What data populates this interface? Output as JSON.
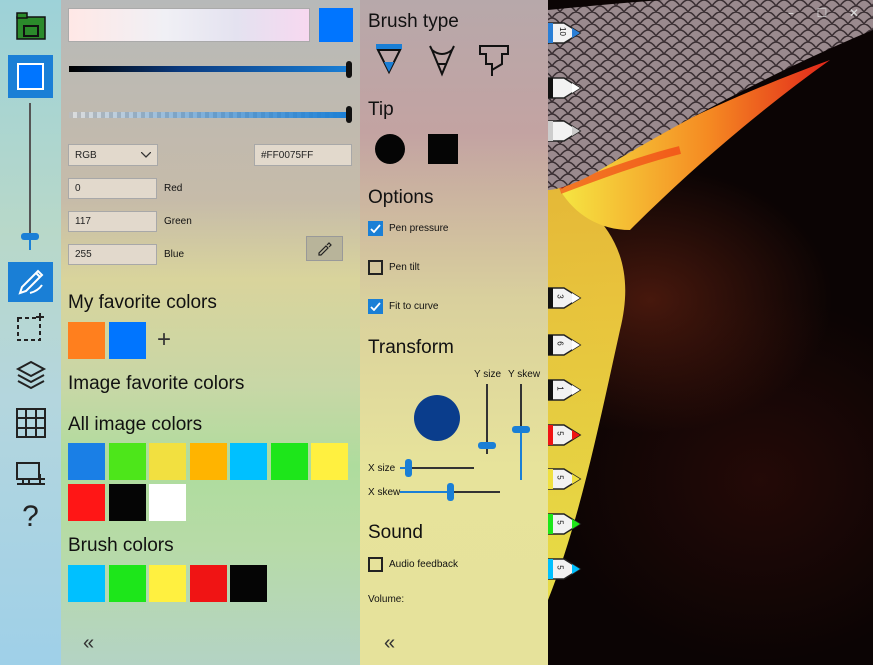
{
  "window": {
    "minimize": "–",
    "maximize": "☐",
    "close": "✕"
  },
  "toolbar": {
    "items": [
      {
        "name": "gallery",
        "icon": "gallery-icon"
      },
      {
        "name": "current-color",
        "icon": "color-square-icon"
      },
      {
        "name": "brush",
        "icon": "brush-icon"
      },
      {
        "name": "selection",
        "icon": "selection-icon"
      },
      {
        "name": "layers",
        "icon": "layers-icon"
      },
      {
        "name": "grid",
        "icon": "grid-icon"
      },
      {
        "name": "canvas-size",
        "icon": "canvas-size-icon"
      },
      {
        "name": "help",
        "icon": "help-icon",
        "glyph": "?"
      }
    ],
    "brush_size_level": 0.1
  },
  "color_panel": {
    "current_color": "#0075FF",
    "hue_value": 1.0,
    "alpha_value": 1.0,
    "mode": "RGB",
    "hex": "#FF0075FF",
    "channels": [
      {
        "value": "0",
        "label": "Red"
      },
      {
        "value": "117",
        "label": "Green"
      },
      {
        "value": "255",
        "label": "Blue"
      }
    ],
    "my_favorites_title": "My favorite colors",
    "my_favorites": [
      "#ff7f1e",
      "#0075ff"
    ],
    "add_glyph": "+",
    "image_favorites_title": "Image favorite colors",
    "all_image_colors_title": "All image colors",
    "all_image_colors": [
      "#1a7fe6",
      "#4de61a",
      "#f2e040",
      "#ffb400",
      "#00c0ff",
      "#1de61a",
      "#fff040",
      "#ff1616",
      "#050505",
      "#ffffff"
    ],
    "brush_colors_title": "Brush colors",
    "brush_colors": [
      "#00c0ff",
      "#1de61a",
      "#fff040",
      "#f01414",
      "#050505"
    ],
    "collapse_glyph": "«"
  },
  "brush_panel": {
    "brush_type_title": "Brush type",
    "brush_types": [
      "pen-brush-icon",
      "pencil-brush-icon",
      "marker-brush-icon"
    ],
    "tip_title": "Tip",
    "tips": [
      "round-tip-icon",
      "square-tip-icon"
    ],
    "options_title": "Options",
    "options": [
      {
        "label": "Pen pressure",
        "checked": true
      },
      {
        "label": "Pen tilt",
        "checked": false
      },
      {
        "label": "Fit to curve",
        "checked": true
      }
    ],
    "transform_title": "Transform",
    "y_size_label": "Y size",
    "y_skew_label": "Y skew",
    "x_size_label": "X size",
    "x_skew_label": "X skew",
    "preview_color": "#0a3d8c",
    "sound_title": "Sound",
    "audio_label": "Audio feedback",
    "audio_checked": false,
    "volume_label": "Volume:",
    "collapse_glyph": "«"
  },
  "canvas_brushes": [
    {
      "size": "10",
      "color": "#2a7fd6"
    },
    {
      "size": "",
      "color": "#ffffff"
    },
    {
      "size": "",
      "color": "#cccccc"
    },
    {
      "size": "3",
      "color": "#ffffff"
    },
    {
      "size": "6",
      "color": "#ffffff"
    },
    {
      "size": "1",
      "color": "#ffffff"
    },
    {
      "size": "5",
      "color": "#f01414"
    },
    {
      "size": "5",
      "color": "#f0e040"
    },
    {
      "size": "5",
      "color": "#1de61a"
    },
    {
      "size": "5",
      "color": "#00c0ff"
    }
  ]
}
